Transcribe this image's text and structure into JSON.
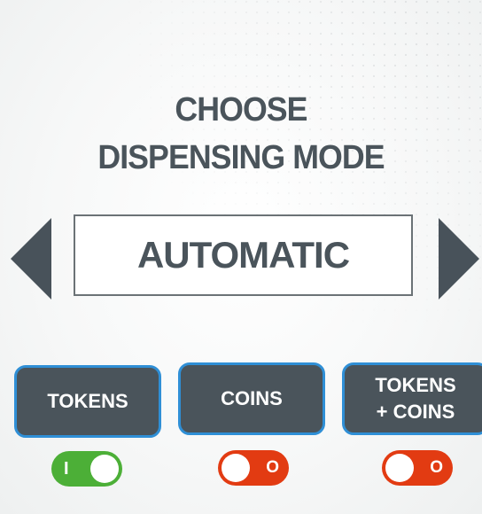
{
  "title": {
    "line1": "CHOOSE",
    "line2": "DISPENSING MODE"
  },
  "mode_selector": {
    "prev_icon": "triangle-left-icon",
    "next_icon": "triangle-right-icon",
    "current_value": "AUTOMATIC"
  },
  "options": [
    {
      "label_line1": "TOKENS",
      "label_line2": "",
      "toggle_state": "on",
      "toggle_mark": "I"
    },
    {
      "label_line1": "COINS",
      "label_line2": "",
      "toggle_state": "off",
      "toggle_mark": "O"
    },
    {
      "label_line1": "TOKENS",
      "label_line2": "+ COINS",
      "toggle_state": "off",
      "toggle_mark": "O"
    }
  ],
  "colors": {
    "dark": "#4a545b",
    "accent_border": "#2f8fd6",
    "toggle_on": "#4caf37",
    "toggle_off": "#e23b12"
  }
}
